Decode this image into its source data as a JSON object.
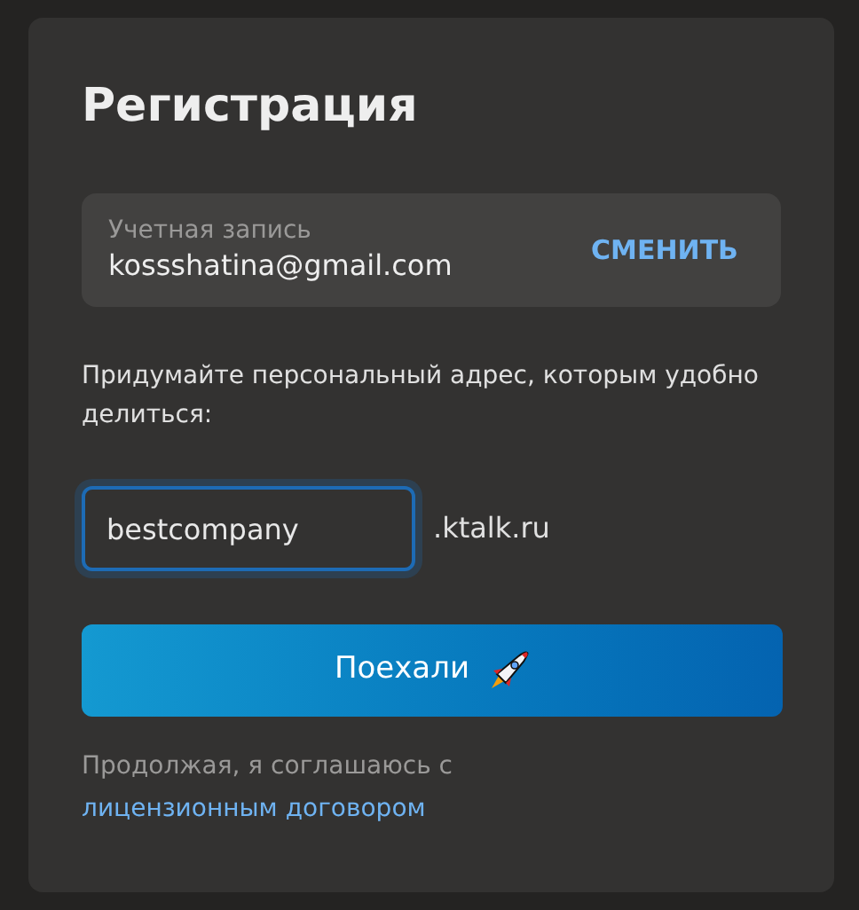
{
  "title": "Регистрация",
  "account": {
    "label": "Учетная запись",
    "email": "kossshatina@gmail.com",
    "change_button": "СМЕНИТЬ"
  },
  "prompt": "Придумайте персональный адрес, которым удобно делиться:",
  "address": {
    "value": "bestcompany",
    "focused": true,
    "suffix": ".ktalk.ru"
  },
  "submit_button": "Поехали",
  "consent": {
    "text": "Продолжая, я соглашаюсь с ",
    "link": "лицензионным договором"
  }
}
